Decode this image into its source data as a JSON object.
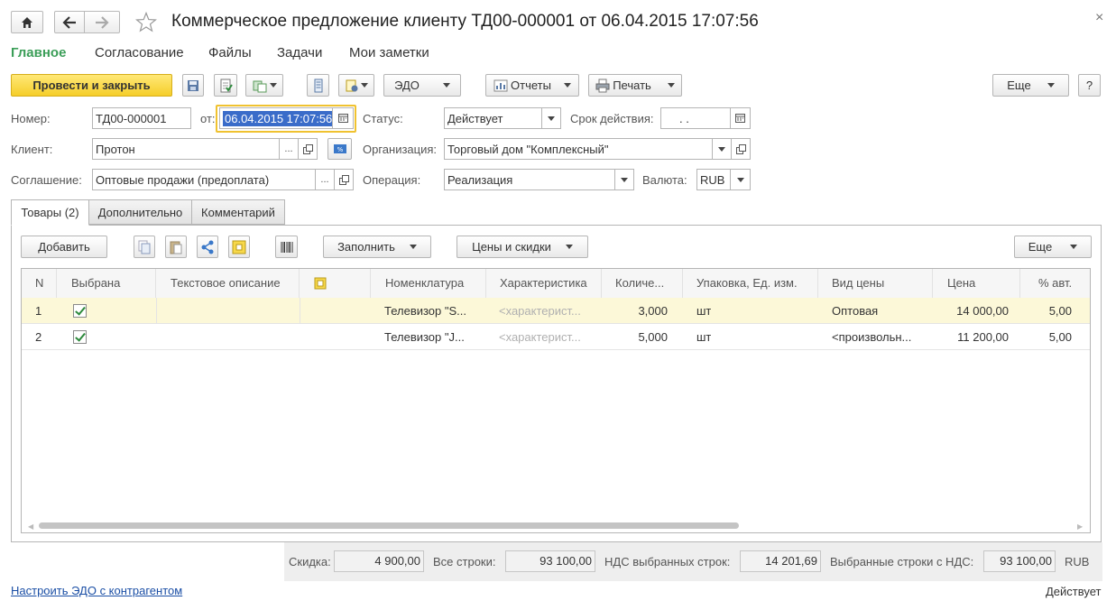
{
  "window": {
    "title": "Коммерческое предложение клиенту ТД00-000001 от 06.04.2015 17:07:56",
    "close_glyph": "×"
  },
  "menu": [
    "Главное",
    "Согласование",
    "Файлы",
    "Задачи",
    "Мои заметки"
  ],
  "toolbar": {
    "post_close": "Провести и закрыть",
    "edo": "ЭДО",
    "reports": "Отчеты",
    "print": "Печать",
    "more": "Еще",
    "help": "?"
  },
  "form": {
    "number_label": "Номер:",
    "number_value": "ТД00-000001",
    "from_label": "от:",
    "date_value": "06.04.2015 17:07:56",
    "status_label": "Статус:",
    "status_value": "Действует",
    "validity_label": "Срок действия:",
    "validity_value": ". .",
    "client_label": "Клиент:",
    "client_value": "Протон",
    "org_label": "Организация:",
    "org_value": "Торговый дом \"Комплексный\"",
    "agreement_label": "Соглашение:",
    "agreement_value": "Оптовые продажи (предоплата)",
    "operation_label": "Операция:",
    "operation_value": "Реализация",
    "currency_label": "Валюта:",
    "currency_value": "RUB",
    "dots": "..."
  },
  "tabs": [
    "Товары (2)",
    "Дополнительно",
    "Комментарий"
  ],
  "table_toolbar": {
    "add": "Добавить",
    "fill": "Заполнить",
    "prices": "Цены и скидки",
    "more": "Еще"
  },
  "table": {
    "columns": [
      "N",
      "Выбрана",
      "Текстовое описание",
      "",
      "Номенклатура",
      "Характеристика",
      "Количе...",
      "Упаковка, Ед. изм.",
      "Вид цены",
      "Цена",
      "% авт."
    ],
    "rows": [
      {
        "n": "1",
        "selected": true,
        "text": "",
        "nom": "Телевизор \"S...",
        "char": "<характерист...",
        "qty": "3,000",
        "unit": "шт",
        "price_type": "Оптовая",
        "price": "14 000,00",
        "auto": "5,00"
      },
      {
        "n": "2",
        "selected": true,
        "text": "",
        "nom": "Телевизор \"J...",
        "char": "<характерист...",
        "qty": "5,000",
        "unit": "шт",
        "price_type": "<произвольн...",
        "price": "11 200,00",
        "auto": "5,00"
      }
    ]
  },
  "totals": {
    "discount_label": "Скидка:",
    "discount_value": "4 900,00",
    "all_label": "Все строки:",
    "all_value": "93 100,00",
    "vat_label": "НДС выбранных строк:",
    "vat_value": "14 201,69",
    "sel_label": "Выбранные строки с НДС:",
    "sel_value": "93 100,00",
    "currency": "RUB"
  },
  "status_bar": {
    "link": "Настроить ЭДО с контрагентом",
    "state": "Действует"
  }
}
